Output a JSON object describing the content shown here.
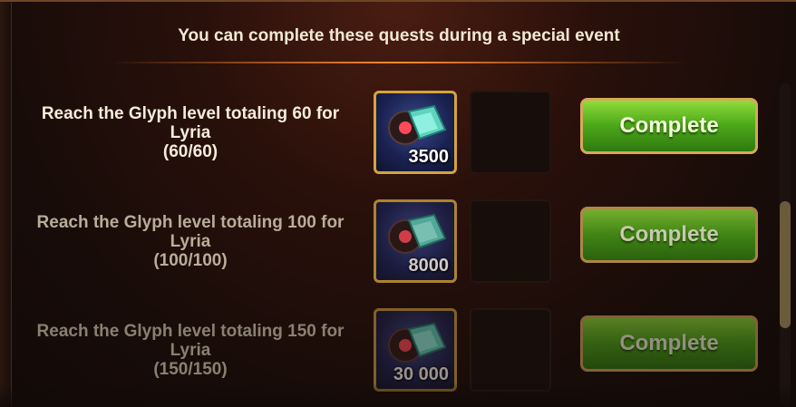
{
  "header": {
    "title": "You can complete these quests during a special event"
  },
  "quests": [
    {
      "line1": "Reach the Glyph level totaling 60 for",
      "line2": "Lyria",
      "progress": "(60/60)",
      "reward_icon": "glyph-crystal-icon",
      "reward_amount": "3500",
      "button_label": "Complete",
      "state": "active"
    },
    {
      "line1": "Reach the Glyph level totaling 100 for",
      "line2": "Lyria",
      "progress": "(100/100)",
      "reward_icon": "glyph-crystal-icon",
      "reward_amount": "8000",
      "button_label": "Complete",
      "state": "faded"
    },
    {
      "line1": "Reach the Glyph level totaling 150 for",
      "line2": "Lyria",
      "progress": "(150/150)",
      "reward_icon": "glyph-crystal-icon",
      "reward_amount": "30 000",
      "button_label": "Complete",
      "state": "faded"
    }
  ],
  "colors": {
    "accent_gold": "#d3a43c",
    "button_green": "#4da81a",
    "header_glow": "#ff8a2a"
  }
}
